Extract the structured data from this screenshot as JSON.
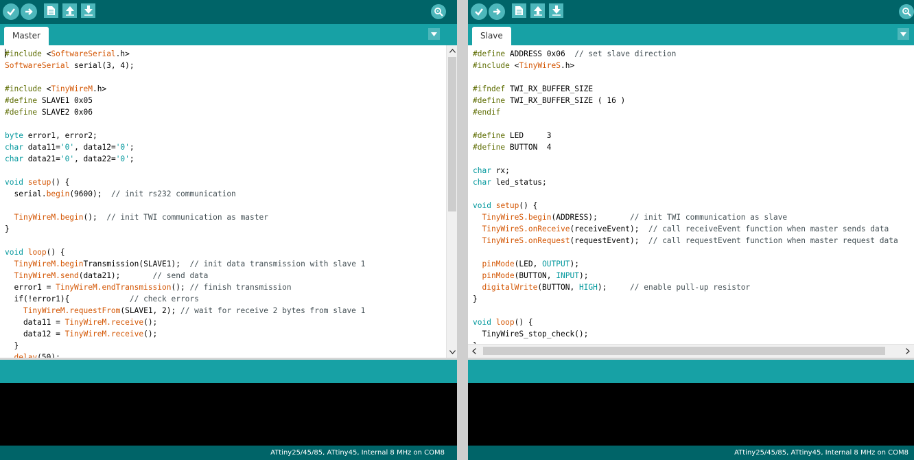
{
  "left_window": {
    "tab_label": "Master",
    "status_text": "ATtiny25/45/85, ATtiny45, Internal 8 MHz on COM8",
    "toolbar_icons": [
      "verify-icon",
      "upload-icon",
      "new-icon",
      "open-icon",
      "save-icon",
      "serial-monitor-icon"
    ],
    "code_lines": [
      "#include <SoftwareSerial.h>",
      "SoftwareSerial serial(3, 4);",
      "",
      "#include <TinyWireM.h>",
      "#define SLAVE1 0x05",
      "#define SLAVE2 0x06",
      "",
      "byte error1, error2;",
      "char data11='0', data12='0';",
      "char data21='0', data22='0';",
      "",
      "void setup() {",
      "  serial.begin(9600);  // init rs232 communication",
      "",
      "  TinyWireM.begin();  // init TWI communication as master",
      "}",
      "",
      "void loop() {",
      "  TinyWireM.beginTransmission(SLAVE1);  // init data transmission with slave 1",
      "  TinyWireM.send(data21);       // send data",
      "  error1 = TinyWireM.endTransmission(); // finish transmission",
      "  if(!error1){             // check errors",
      "    TinyWireM.requestFrom(SLAVE1, 2); // wait for receive 2 bytes from slave 1",
      "    data11 = TinyWireM.receive();",
      "    data12 = TinyWireM.receive();",
      "  }",
      "  delay(50);"
    ]
  },
  "right_window": {
    "tab_label": "Slave",
    "status_text": "ATtiny25/45/85, ATtiny45, Internal 8 MHz on COM8",
    "toolbar_icons": [
      "verify-icon",
      "upload-icon",
      "new-icon",
      "open-icon",
      "save-icon",
      "serial-monitor-icon"
    ],
    "code_lines": [
      "#define ADDRESS 0x06  // set slave direction",
      "#include <TinyWireS.h>",
      "",
      "#ifndef TWI_RX_BUFFER_SIZE",
      "#define TWI_RX_BUFFER_SIZE ( 16 )",
      "#endif",
      "",
      "#define LED     3",
      "#define BUTTON  4",
      "",
      "char rx;",
      "char led_status;",
      "",
      "void setup() {",
      "  TinyWireS.begin(ADDRESS);       // init TWI communication as slave",
      "  TinyWireS.onReceive(receiveEvent);  // call receiveEvent function when master sends data",
      "  TinyWireS.onRequest(requestEvent);  // call requestEvent function when master request data",
      "",
      "  pinMode(LED, OUTPUT);",
      "  pinMode(BUTTON, INPUT);",
      "  digitalWrite(BUTTON, HIGH);     // enable pull-up resistor",
      "}",
      "",
      "void loop() {",
      "  TinyWireS_stop_check();",
      "}"
    ]
  },
  "colors": {
    "toolbar": "#006468",
    "tabbar": "#17a1a5",
    "button": "#4db7bb",
    "console": "#000000",
    "keyword_type": "#00979c",
    "keyword_library": "#d35400",
    "comment": "#434f54"
  }
}
